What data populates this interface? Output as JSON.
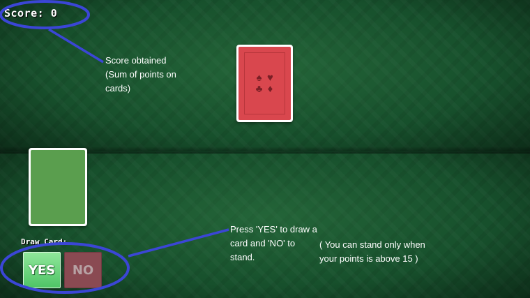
{
  "score": {
    "label": "Score: 0"
  },
  "notes": {
    "score_explanation": [
      "Score obtained",
      "(Sum of points on",
      "cards)"
    ],
    "press_instruction": [
      "Press 'YES' to draw a",
      "card and 'NO' to",
      "stand."
    ],
    "stand_rule": [
      "( You can stand only when",
      "your points is above 15 )"
    ]
  },
  "dealer_card": {
    "suits": [
      "♠",
      "♥",
      "♣",
      "♦"
    ]
  },
  "controls": {
    "draw_label": "Draw Card:",
    "yes_label": "YES",
    "no_label": "NO"
  },
  "colors": {
    "felt": "#17502c",
    "card_back": "#d9474e",
    "player_card": "#5a9e4e",
    "yes_button": "#4fc466",
    "no_button": "#8a4a52",
    "annotation": "#3b46d6"
  }
}
